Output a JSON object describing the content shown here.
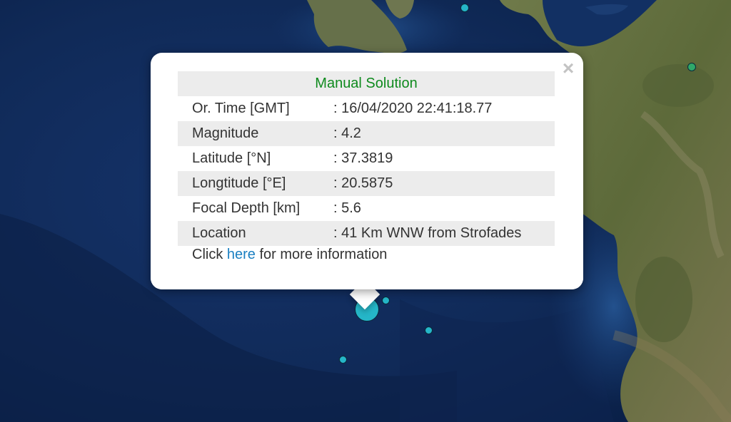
{
  "popup": {
    "title": "Manual Solution",
    "close_symbol": "×",
    "rows": [
      {
        "label": "Or. Time [GMT]",
        "value": ": 16/04/2020 22:41:18.77"
      },
      {
        "label": "Magnitude",
        "value": ": 4.2"
      },
      {
        "label": "Latitude [°N]",
        "value": ": 37.3819"
      },
      {
        "label": "Longtitude [°E]",
        "value": ": 20.5875"
      },
      {
        "label": "Focal Depth [km]",
        "value": ": 5.6"
      },
      {
        "label": "Location",
        "value": ": 41 Km WNW from Strofades"
      }
    ],
    "footer_prefix": "Click ",
    "footer_link": "here",
    "footer_suffix": " for more information"
  },
  "colors": {
    "title": "#0f8a1e",
    "link": "#1a7fc1",
    "quake_marker": "#25b6c8",
    "quake_marker_land": "#2fa86a"
  },
  "markers": {
    "icon": "earthquake-marker-icon"
  }
}
